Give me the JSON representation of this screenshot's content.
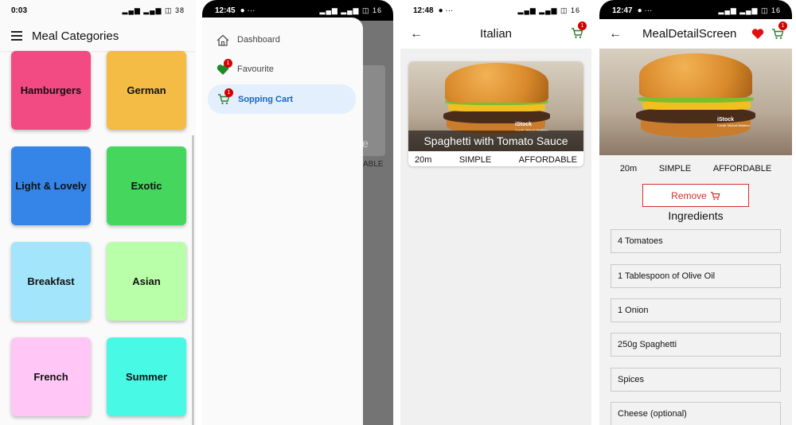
{
  "screen1": {
    "status": {
      "time": "0:03",
      "right": "▂▄▆ ▂▄▆ ◫ 38"
    },
    "title": "Meal Categories",
    "categories": [
      {
        "label": "Hamburgers",
        "color": "#f24a82"
      },
      {
        "label": "German",
        "color": "#f4bb45"
      },
      {
        "label": "Light & Lovely",
        "color": "#3585e9"
      },
      {
        "label": "Exotic",
        "color": "#45d65e"
      },
      {
        "label": "Breakfast",
        "color": "#a3e6fb"
      },
      {
        "label": "Asian",
        "color": "#b9ffa9"
      },
      {
        "label": "French",
        "color": "#ffc6f6"
      },
      {
        "label": "Summer",
        "color": "#48f9e6"
      }
    ]
  },
  "screen2": {
    "status": {
      "time": "12:45",
      "right": "▂▄▆ ▂▄▆ ◫ 16"
    },
    "drawer": {
      "items": [
        {
          "label": "Dashboard",
          "icon": "home-icon"
        },
        {
          "label": "Favourite",
          "icon": "heart-icon",
          "badge": "1"
        },
        {
          "label": "Sopping Cart",
          "icon": "cart-icon",
          "badge": "1"
        }
      ]
    },
    "behind": {
      "card_text": "ce",
      "info": "ABLE"
    }
  },
  "screen3": {
    "status": {
      "time": "12:48",
      "right": "▂▄▆ ▂▄▆ ◫ 16"
    },
    "title": "Italian",
    "cart_badge": "1",
    "meal": {
      "title": "Spaghetti with Tomato Sauce",
      "duration": "20m",
      "complexity": "SIMPLE",
      "affordability": "AFFORDABLE",
      "watermark": "iStock",
      "credit": "Credit: Mikhail Bilalteev"
    }
  },
  "screen4": {
    "status": {
      "time": "12:47",
      "right": "▂▄▆ ▂▄▆ ◫ 16"
    },
    "title": "MealDetailScreen",
    "cart_badge": "1",
    "watermark": "iStock",
    "credit": "Credit: Mikhail Bilalteev",
    "duration": "20m",
    "complexity": "SIMPLE",
    "affordability": "AFFORDABLE",
    "remove_label": "Remove",
    "ingredients_heading": "Ingredients",
    "ingredients": [
      "4 Tomatoes",
      "1 Tablespoon of Olive Oil",
      "1 Onion",
      "250g Spaghetti",
      "Spices",
      "Cheese (optional)"
    ]
  },
  "colors": {
    "drawer_selected": "#e3effc",
    "drawer_selected_text": "#1565c0",
    "remove_red": "#d32f2f",
    "cart_green": "#2e7d32"
  }
}
